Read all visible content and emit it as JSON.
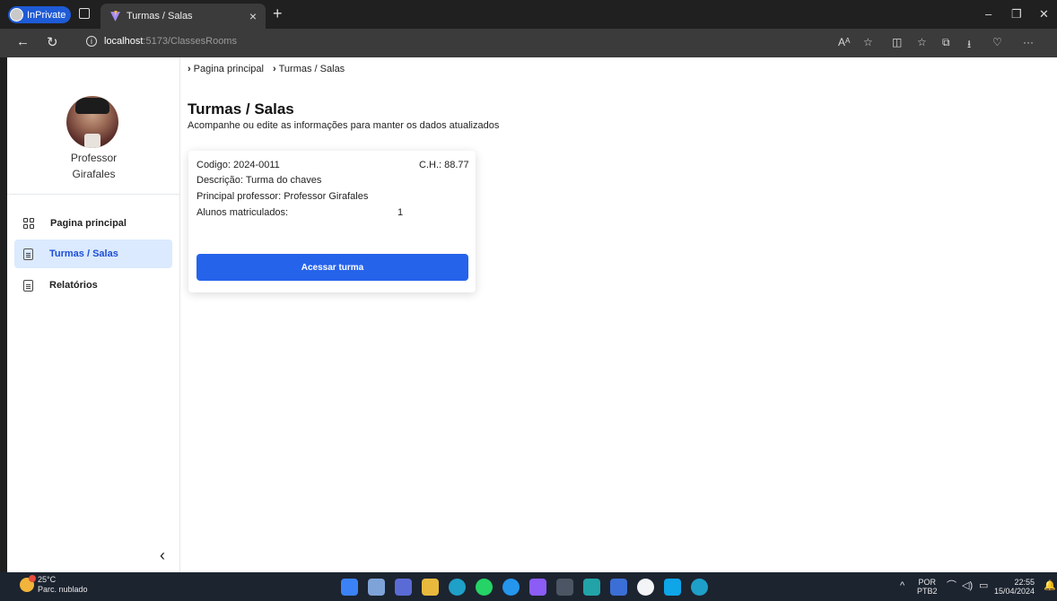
{
  "browser": {
    "inprivate_label": "InPrivate",
    "tab_title": "Turmas / Salas",
    "url_host": "localhost",
    "url_path": ":5173/ClassesRooms"
  },
  "sidebar": {
    "professor_name_line1": "Professor",
    "professor_name_line2": "Girafales",
    "items": [
      {
        "label": "Pagina principal",
        "icon": "grid-icon",
        "active": false
      },
      {
        "label": "Turmas / Salas",
        "icon": "document-icon",
        "active": true
      },
      {
        "label": "Relatórios",
        "icon": "document-icon",
        "active": false
      }
    ],
    "collapse_glyph": "‹"
  },
  "breadcrumb": {
    "items": [
      "Pagina principal",
      "Turmas / Salas"
    ],
    "separator_glyph": "›"
  },
  "page": {
    "title": "Turmas / Salas",
    "subtitle": "Acompanhe ou edite as informações para manter os dados atualizados"
  },
  "class_card": {
    "codigo": "Codigo: 2024-0011",
    "ch": "C.H.: 88.77",
    "descricao": "Descrição: Turma do chaves",
    "principal": "Principal professor: Professor Girafales",
    "alunos_label": "Alunos matriculados:",
    "alunos_count": "1",
    "button_label": "Acessar turma"
  },
  "taskbar": {
    "temperature": "25°C",
    "weather": "Parc. nublado",
    "weather_badge": "1",
    "lang_line1": "POR",
    "lang_line2": "PTB2",
    "time": "22:55",
    "date": "15/04/2024"
  },
  "colors": {
    "accent": "#2563eb",
    "active_nav_bg": "#dbeafe",
    "active_nav_text": "#1d4ed8"
  }
}
